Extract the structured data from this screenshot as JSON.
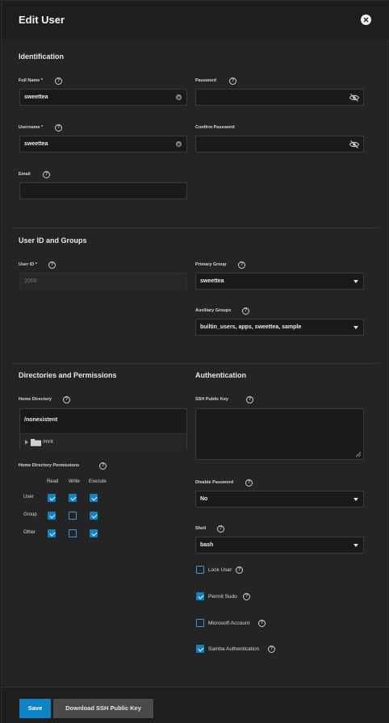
{
  "dialog": {
    "title": "Edit User"
  },
  "identification": {
    "heading": "Identification",
    "full_name": {
      "label": "Full Name *",
      "value": "sweettea"
    },
    "password": {
      "label": "Password",
      "value": ""
    },
    "username": {
      "label": "Username *",
      "value": "sweettea"
    },
    "confirm_password": {
      "label": "Confirm Password",
      "value": ""
    },
    "email": {
      "label": "Email",
      "value": ""
    }
  },
  "user_id_groups": {
    "heading": "User ID and Groups",
    "user_id": {
      "label": "User ID *",
      "value": "1000"
    },
    "primary_group": {
      "label": "Primary Group",
      "value": "sweettea"
    },
    "auxiliary_groups": {
      "label": "Auxiliary Groups",
      "value": "builtin_users, apps, sweettea, sample"
    }
  },
  "directories": {
    "heading": "Directories and Permissions",
    "home_directory": {
      "label": "Home Directory",
      "path": "/nonexistent",
      "tree_item": "/mnt"
    },
    "permissions": {
      "label": "Home Directory Permissions",
      "columns": [
        "Read",
        "Write",
        "Execute"
      ],
      "rows": [
        {
          "name": "User",
          "values": [
            true,
            true,
            true
          ]
        },
        {
          "name": "Group",
          "values": [
            true,
            false,
            true
          ]
        },
        {
          "name": "Other",
          "values": [
            true,
            false,
            true
          ]
        }
      ]
    }
  },
  "authentication": {
    "heading": "Authentication",
    "ssh_key": {
      "label": "SSH Public Key",
      "value": ""
    },
    "disable_password": {
      "label": "Disable Password",
      "value": "No"
    },
    "shell": {
      "label": "Shell",
      "value": "bash"
    },
    "checkboxes": [
      {
        "label": "Lock User",
        "checked": false
      },
      {
        "label": "Permit Sudo",
        "checked": true
      },
      {
        "label": "Microsoft Account",
        "checked": false
      },
      {
        "label": "Samba Authentication",
        "checked": true
      }
    ]
  },
  "footer": {
    "save_label": "Save",
    "download_label": "Download SSH Public Key"
  },
  "colors": {
    "accent": "#0d84c6",
    "background": "#242424",
    "input_bg": "#1a1a1a"
  },
  "icons": {
    "close": "close-icon",
    "help": "help-icon",
    "eye": "eye-off-icon",
    "clear": "clear-icon",
    "folder": "folder-icon"
  }
}
